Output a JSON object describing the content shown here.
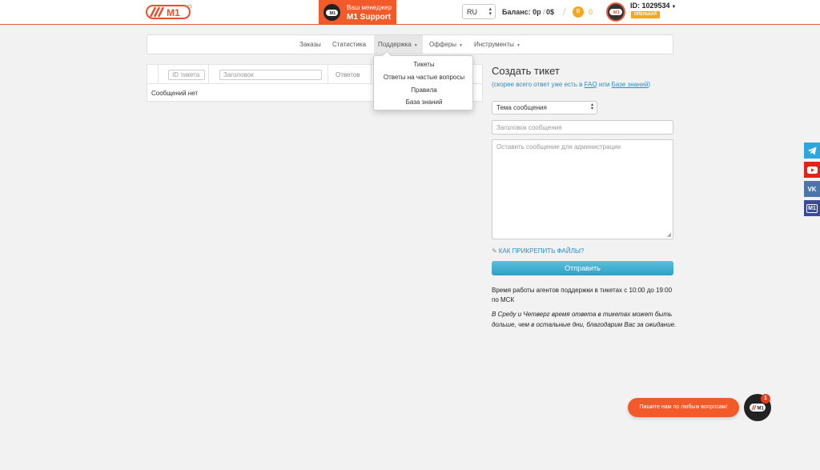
{
  "header": {
    "logo_text": "M1",
    "manager_label": "Ваш менеджер",
    "manager_name": "M1 Support",
    "manager_badge": "M1",
    "language": "RU",
    "balance_label": "Баланс: 0р",
    "balance_sep": "/",
    "balance_usd": "0$",
    "coin_icon_text": "B",
    "coin_value": "0",
    "avatar_text": "M1",
    "user_id": "ID: 1029534",
    "status_badge": "ОПЕНЬКАЙ"
  },
  "nav": {
    "items": [
      {
        "label": "Заказы"
      },
      {
        "label": "Статистика"
      },
      {
        "label": "Поддержка"
      },
      {
        "label": "Офферы"
      },
      {
        "label": "Инструменты"
      }
    ]
  },
  "support_menu": {
    "items": [
      "Тикеты",
      "Ответы на частые вопросы",
      "Правила",
      "База знаний"
    ]
  },
  "tickets_table": {
    "id_placeholder": "ID тикета",
    "title_placeholder": "Заголовок",
    "col_answers": "Ответов",
    "empty_text": "Сообщений нет"
  },
  "create_ticket": {
    "title": "Создать тикет",
    "hint_prefix": "(скорее всего ответ уже есть в",
    "hint_faq": "FAQ",
    "hint_or": "или",
    "hint_kb": "Базе знаний",
    "hint_suffix": ")",
    "topic_select": "Тема сообщения",
    "subject_placeholder": "Заголовок сообщения",
    "message_placeholder": "Оставить сообщение для администрации",
    "attach_link": "КАК ПРИКРЕПИТЬ ФАЙЛЫ?",
    "submit": "Отправить",
    "info_hours": "Время работы агентов поддержки в тикетах с 10:00 до 19:00 по МСК",
    "info_note": "В Среду и Четверг время ответа в тикетах может быть дольше, чем в остальные дни, благодарим Вас за ожидание."
  },
  "social": {
    "telegram_color": "#2ca5e0",
    "youtube_color": "#e62117",
    "vk_color": "#4a76a8",
    "m1_color": "#3b4b9a",
    "vk_text": "VK",
    "m1_text": "M1"
  },
  "chat": {
    "prompt": "Пишите нам по любым вопросам!",
    "unread_count": "1",
    "button_text": "M1"
  },
  "colors": {
    "accent": "#f25a2a",
    "link": "#2a8ec7",
    "coin": "#f5a623"
  }
}
